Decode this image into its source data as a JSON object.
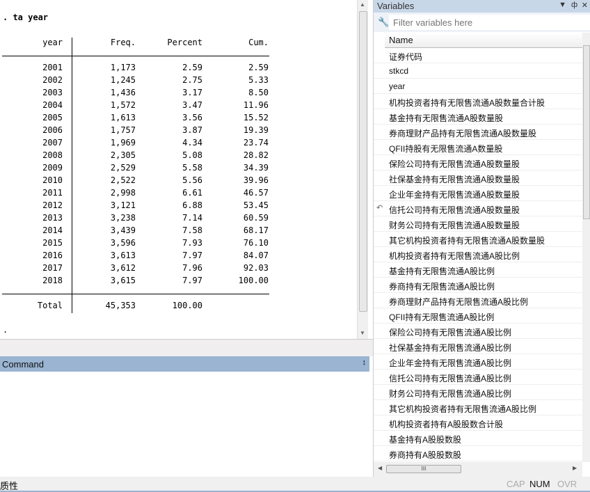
{
  "results": {
    "command": ". ta year",
    "headers": [
      "year",
      "Freq.",
      "Percent",
      "Cum."
    ],
    "rows": [
      [
        "2001",
        "1,173",
        "2.59",
        "2.59"
      ],
      [
        "2002",
        "1,245",
        "2.75",
        "5.33"
      ],
      [
        "2003",
        "1,436",
        "3.17",
        "8.50"
      ],
      [
        "2004",
        "1,572",
        "3.47",
        "11.96"
      ],
      [
        "2005",
        "1,613",
        "3.56",
        "15.52"
      ],
      [
        "2006",
        "1,757",
        "3.87",
        "19.39"
      ],
      [
        "2007",
        "1,969",
        "4.34",
        "23.74"
      ],
      [
        "2008",
        "2,305",
        "5.08",
        "28.82"
      ],
      [
        "2009",
        "2,529",
        "5.58",
        "34.39"
      ],
      [
        "2010",
        "2,522",
        "5.56",
        "39.96"
      ],
      [
        "2011",
        "2,998",
        "6.61",
        "46.57"
      ],
      [
        "2012",
        "3,121",
        "6.88",
        "53.45"
      ],
      [
        "2013",
        "3,238",
        "7.14",
        "60.59"
      ],
      [
        "2014",
        "3,439",
        "7.58",
        "68.17"
      ],
      [
        "2015",
        "3,596",
        "7.93",
        "76.10"
      ],
      [
        "2016",
        "3,613",
        "7.97",
        "84.07"
      ],
      [
        "2017",
        "3,612",
        "7.96",
        "92.03"
      ],
      [
        "2018",
        "3,615",
        "7.97",
        "100.00"
      ]
    ],
    "total": [
      "Total",
      "45,353",
      "100.00",
      ""
    ],
    "prompt": "."
  },
  "command_panel": {
    "title": "Command",
    "pin_icon": "pin-icon"
  },
  "variables": {
    "title": "Variables",
    "filter_placeholder": "Filter variables here",
    "column_header": "Name",
    "items": [
      "证券代码",
      "stkcd",
      "year",
      "机构投资者持有无限售流通A股数量合计股",
      "基金持有无限售流通A股数量股",
      "券商理财产品持有无限售流通A股数量股",
      "QFII持股有无限售流通A数量股",
      "保险公司持有无限售流通A股数量股",
      "社保基金持有无限售流通A股数量股",
      "企业年金持有无限售流通A股数量股",
      "信托公司持有无限售流通A股数量股",
      "财务公司持有无限售流通A股数量股",
      "其它机构投资者持有无限售流通A股数量股",
      "机构投资者持有无限售流通A股比例",
      "基金持有无限售流通A股比例",
      "券商持有无限售流通A股比例",
      "券商理财产品持有无限售流通A股比例",
      "QFII持有无限售流通A股比例",
      "保险公司持有无限售流通A股比例",
      "社保基金持有无限售流通A股比例",
      "企业年金持有无限售流通A股比例",
      "信托公司持有无限售流通A股比例",
      "财务公司持有无限售流通A股比例",
      "其它机构投资者持有无限售流通A股比例",
      "机构投资者持有A股股数合计股",
      "基金持有A股股数股",
      "券商持有A股股数股"
    ]
  },
  "status": {
    "left": "质性",
    "cap": "CAP",
    "num": "NUM",
    "ovr": "OVR"
  }
}
